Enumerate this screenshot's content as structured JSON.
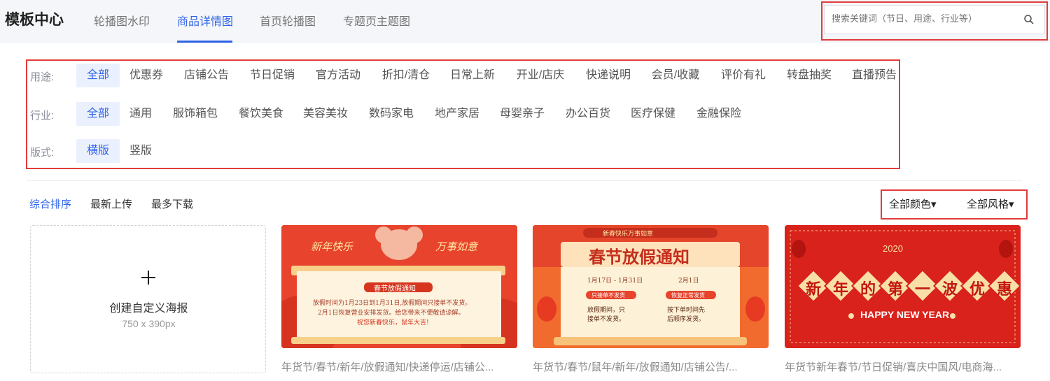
{
  "header": {
    "title": "模板中心",
    "tabs": [
      {
        "label": "轮播图水印"
      },
      {
        "label": "商品详情图"
      },
      {
        "label": "首页轮播图"
      },
      {
        "label": "专题页主题图"
      }
    ],
    "search_placeholder": "搜索关键词（节日、用途、行业等）"
  },
  "filters": {
    "usage": {
      "label": "用途:",
      "options": [
        "全部",
        "优惠券",
        "店铺公告",
        "节日促销",
        "官方活动",
        "折扣/清仓",
        "日常上新",
        "开业/店庆",
        "快递说明",
        "会员/收藏",
        "评价有礼",
        "转盘抽奖",
        "直播预告"
      ]
    },
    "industry": {
      "label": "行业:",
      "options": [
        "全部",
        "通用",
        "服饰箱包",
        "餐饮美食",
        "美容美妆",
        "数码家电",
        "地产家居",
        "母婴亲子",
        "办公百货",
        "医疗保健",
        "金融保险"
      ]
    },
    "layout": {
      "label": "版式:",
      "options": [
        "横版",
        "竖版"
      ]
    }
  },
  "sort": {
    "options": [
      "综合排序",
      "最新上传",
      "最多下载"
    ]
  },
  "dropdowns": {
    "color": "全部颜色▾",
    "style": "全部风格▾"
  },
  "create_card": {
    "label": "创建自定义海报",
    "size": "750 x 390px"
  },
  "cards": [
    {
      "caption": "年货节/春节/新年/放假通知/快递停运/店铺公...",
      "poster": {
        "left_text": "新年快乐",
        "right_text": "万事如意",
        "banner": "春节放假通知",
        "line1": "放假时间为1月23日到1月31日,放假期间只接单不发货。",
        "line2": "2月1日恢复营业安排发货。给您带来不便敬请谅解。",
        "line3": "祝您新春快乐，鼠年大吉!"
      }
    },
    {
      "caption": "年货节/春节/鼠年/新年/放假通知/店铺公告/...",
      "poster": {
        "top_badge": "新春快乐万事如意",
        "title": "春节放假通知",
        "date_left": "1月17日 - 1月31日",
        "date_right": "2月1日",
        "tag_left": "只接单不发货",
        "tag_right": "恢复正常发货",
        "body_left": "放假期间，只接单不发货。",
        "body_right": "按下单时间先后顺序发货。"
      }
    },
    {
      "caption": "年货节新年春节/节日促销/喜庆中国风/电商海...",
      "poster": {
        "year": "2020",
        "chars": [
          "新",
          "年",
          "的",
          "第",
          "一",
          "波",
          "优",
          "惠"
        ],
        "subtitle": "HAPPY NEW YEAR"
      }
    }
  ],
  "colors": {
    "accent": "#2f63e8",
    "highlight_border": "#e23b3b",
    "poster_red": "#e8432c",
    "poster_gold": "#f7d08a"
  }
}
